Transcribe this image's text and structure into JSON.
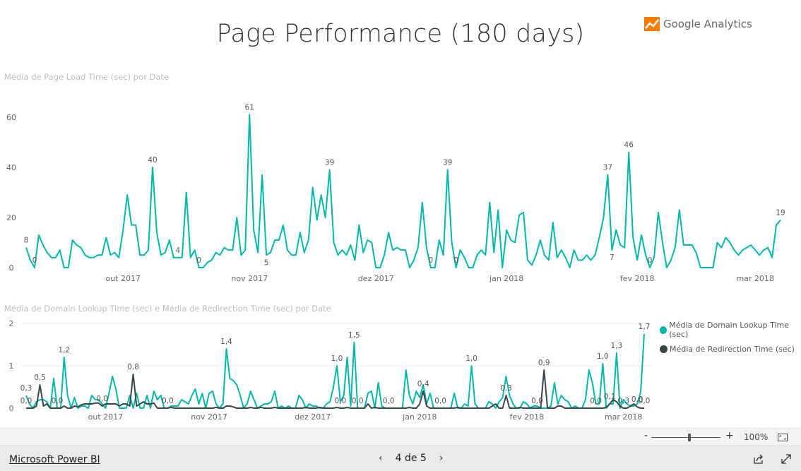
{
  "title": "Page Performance (180 days)",
  "logo": {
    "text": "Google Analytics",
    "color": "#f57c00"
  },
  "charts": [
    {
      "title": "Média de Page Load Time (sec) por Date",
      "type": "line",
      "ylim": [
        0,
        60
      ],
      "yticks": [
        "0",
        "20",
        "40",
        "60"
      ],
      "ytick_values": [
        0,
        20,
        40,
        60
      ],
      "xticks": [
        {
          "label": "out 2017",
          "at": 23
        },
        {
          "label": "nov 2017",
          "at": 53
        },
        {
          "label": "dez 2017",
          "at": 83
        },
        {
          "label": "jan 2018",
          "at": 114
        },
        {
          "label": "fev 2018",
          "at": 145
        },
        {
          "label": "mar 2018",
          "at": 173
        }
      ],
      "grid": false,
      "series": [
        {
          "name": "Média de Page Load Time (sec)",
          "color": "#01b8aa",
          "values": [
            8,
            3,
            0,
            13,
            9,
            6,
            4,
            4,
            7,
            0,
            0,
            11,
            9,
            8,
            5,
            4,
            4,
            5,
            5,
            12,
            5,
            6,
            4,
            15,
            29,
            17,
            17,
            5,
            5,
            7,
            40,
            14,
            5,
            6,
            11,
            4,
            4,
            4,
            30,
            4,
            7,
            0,
            0,
            2,
            3,
            6,
            5,
            8,
            7,
            7,
            20,
            5,
            7,
            61,
            15,
            6,
            37,
            5,
            6,
            11,
            11,
            17,
            7,
            5,
            5,
            14,
            6,
            11,
            32,
            19,
            29,
            20,
            39,
            10,
            5,
            7,
            5,
            9,
            3,
            17,
            6,
            11,
            10,
            0,
            0,
            5,
            14,
            7,
            8,
            7,
            7,
            0,
            3,
            8,
            26,
            8,
            0,
            0,
            11,
            5,
            39,
            10,
            0,
            7,
            4,
            0,
            0,
            5,
            7,
            5,
            26,
            6,
            23,
            0,
            15,
            11,
            10,
            21,
            22,
            3,
            1,
            5,
            11,
            5,
            3,
            18,
            4,
            7,
            4,
            0,
            7,
            3,
            3,
            5,
            3,
            5,
            12,
            20,
            37,
            7,
            15,
            9,
            8,
            46,
            12,
            3,
            13,
            5,
            0,
            4,
            22,
            10,
            0,
            3,
            8,
            23,
            9,
            9,
            9,
            6,
            0,
            0,
            0,
            0,
            10,
            8,
            12,
            10,
            7,
            5,
            7,
            8,
            9,
            7,
            5,
            7,
            8,
            4,
            17,
            19
          ]
        }
      ],
      "labels": [
        {
          "s": 0,
          "at": 0,
          "text": "8"
        },
        {
          "s": 0,
          "at": 2,
          "text": "0"
        },
        {
          "s": 0,
          "at": 30,
          "text": "40"
        },
        {
          "s": 0,
          "at": 36,
          "text": "4"
        },
        {
          "s": 0,
          "at": 41,
          "text": "0"
        },
        {
          "s": 0,
          "at": 53,
          "text": "61"
        },
        {
          "s": 0,
          "at": 57,
          "text": "5",
          "below": true
        },
        {
          "s": 0,
          "at": 72,
          "text": "39"
        },
        {
          "s": 0,
          "at": 96,
          "text": "0"
        },
        {
          "s": 0,
          "at": 100,
          "text": "39"
        },
        {
          "s": 0,
          "at": 102,
          "text": "0"
        },
        {
          "s": 0,
          "at": 138,
          "text": "37"
        },
        {
          "s": 0,
          "at": 139,
          "text": "7",
          "below": true
        },
        {
          "s": 0,
          "at": 143,
          "text": "46"
        },
        {
          "s": 0,
          "at": 148,
          "text": "0"
        },
        {
          "s": 0,
          "at": 179,
          "text": "19"
        }
      ]
    },
    {
      "title": "Média de Domain Lookup Time (sec) e Média de Redirection Time (sec) por Date",
      "type": "line",
      "ylim": [
        0,
        2
      ],
      "yticks": [
        "0",
        "1",
        "2"
      ],
      "ytick_values": [
        0,
        1,
        2
      ],
      "xticks": [
        {
          "label": "out 2017",
          "at": 23
        },
        {
          "label": "nov 2017",
          "at": 53
        },
        {
          "label": "dez 2017",
          "at": 83
        },
        {
          "label": "jan 2018",
          "at": 114
        },
        {
          "label": "fev 2018",
          "at": 145
        },
        {
          "label": "mar 2018",
          "at": 173
        }
      ],
      "grid": true,
      "legend": "right",
      "series": [
        {
          "name": "Média de Domain Lookup Time (sec)",
          "color": "#01b8aa",
          "values": [
            0.3,
            0.1,
            0,
            0.15,
            0.2,
            0.2,
            0.15,
            0,
            0.7,
            0,
            0,
            1.2,
            0.3,
            0,
            0.25,
            0,
            0.05,
            0.05,
            0,
            0.3,
            0.2,
            0.2,
            0.1,
            0,
            0.35,
            0.75,
            0.45,
            0,
            0,
            0,
            0.3,
            0,
            0.35,
            0,
            0,
            0.3,
            0,
            0.4,
            0.2,
            0.3,
            0,
            0,
            0.05,
            0.05,
            0.05,
            0.2,
            0.15,
            0.1,
            0.3,
            0.45,
            0.1,
            0.35,
            0,
            0.35,
            0.4,
            0.1,
            0,
            0.1,
            1.4,
            0.7,
            0.65,
            0.55,
            0.3,
            0,
            0.1,
            0.4,
            0.2,
            0,
            0.05,
            0.1,
            0.1,
            0.15,
            0.4,
            0,
            0.05,
            0,
            0.05,
            0,
            0,
            0.3,
            0.2,
            0,
            0.1,
            0.05,
            0.05,
            0,
            0,
            0.1,
            0.15,
            0.5,
            1.0,
            0.15,
            0.3,
            1.2,
            0.05,
            1.55,
            0,
            0,
            0,
            0.35,
            0.4,
            0,
            0.6,
            0.05,
            0,
            0,
            0,
            0,
            0,
            0,
            0.9,
            0.3,
            0.1,
            0.4,
            0.25,
            0.55,
            0.1,
            0.35,
            0,
            0,
            0,
            0,
            0,
            0,
            0.35,
            0,
            0,
            0.1,
            0.05,
            1.0,
            0.1,
            0,
            0,
            0,
            0.15,
            0.1,
            0,
            0.15,
            0.25,
            0.75,
            0.3,
            0.1,
            0,
            0,
            0.15,
            0.1,
            0,
            0.05,
            0.05,
            0,
            0,
            0,
            0.05,
            0.6,
            0.1,
            0.3,
            0.2,
            0.15,
            0,
            0.05,
            0,
            0,
            0.2,
            0.9,
            0.6,
            0.1,
            0.1,
            1.05,
            0,
            0.1,
            0.1,
            1.3,
            0,
            0.2,
            0.1,
            0.05,
            0.05,
            0.1,
            0.4,
            1.75
          ]
        },
        {
          "name": "Média de Redirection Time (sec)",
          "color": "#374649",
          "values": [
            0,
            0,
            0,
            0.05,
            0.55,
            0.05,
            0.1,
            0,
            0,
            0,
            0,
            0.05,
            0,
            0,
            0.05,
            0.03,
            0.08,
            0.1,
            0.1,
            0.1,
            0.12,
            0.12,
            0.05,
            0.1,
            0.1,
            0.1,
            0.1,
            0.05,
            0.1,
            0.1,
            0.05,
            0.8,
            0.05,
            0.1,
            0.15,
            0.1,
            0.1,
            0.12,
            0,
            0,
            0,
            0,
            0.02,
            0,
            0,
            0,
            0,
            0,
            0,
            0,
            0,
            0,
            0,
            0,
            0,
            0.02,
            0,
            0,
            0.05,
            0.05,
            0.03,
            0,
            0,
            0,
            0,
            0.02,
            0,
            0,
            0.02,
            0,
            0,
            0,
            0.02,
            0,
            0,
            0,
            0,
            0,
            0,
            0,
            0,
            0.02,
            0,
            0,
            0,
            0.02,
            0,
            0,
            0,
            0,
            0.02,
            0,
            0,
            0.02,
            0,
            0,
            0,
            0,
            0,
            0.1,
            0,
            0.02,
            0,
            0,
            0,
            0,
            0,
            0,
            0,
            0,
            0,
            0.02,
            0,
            0,
            0.1,
            0.4,
            0.05,
            0,
            0,
            0,
            0,
            0,
            0,
            0,
            0,
            0.02,
            0,
            0,
            0,
            0,
            0,
            0,
            0,
            0,
            0,
            0.05,
            0.1,
            0,
            0,
            0.3,
            0,
            0,
            0,
            0.02,
            0,
            0,
            0,
            0,
            0,
            0,
            0.9,
            0,
            0,
            0,
            0.05,
            0.05,
            0,
            0,
            0,
            0,
            0,
            0,
            0,
            0,
            0,
            0,
            0,
            0,
            0.02,
            0.1,
            0.2,
            0.15,
            0.05,
            0,
            0,
            0.05,
            0.1,
            0.03,
            0,
            0
          ]
        }
      ],
      "labels": [
        {
          "s": 0,
          "at": 0,
          "text": "0,3"
        },
        {
          "s": 1,
          "at": 0,
          "text": "0,0"
        },
        {
          "s": 1,
          "at": 4,
          "text": "0,5"
        },
        {
          "s": 1,
          "at": 9,
          "text": "0,0"
        },
        {
          "s": 0,
          "at": 11,
          "text": "1,2"
        },
        {
          "s": 1,
          "at": 22,
          "text": "0,0"
        },
        {
          "s": 1,
          "at": 31,
          "text": "0,8"
        },
        {
          "s": 1,
          "at": 41,
          "text": "0,0"
        },
        {
          "s": 0,
          "at": 58,
          "text": "1,4"
        },
        {
          "s": 0,
          "at": 90,
          "text": "1,0"
        },
        {
          "s": 1,
          "at": 91,
          "text": "0,0"
        },
        {
          "s": 0,
          "at": 95,
          "text": "1,5"
        },
        {
          "s": 1,
          "at": 96,
          "text": "0,0"
        },
        {
          "s": 1,
          "at": 105,
          "text": "0,0"
        },
        {
          "s": 1,
          "at": 115,
          "text": "0,4"
        },
        {
          "s": 1,
          "at": 120,
          "text": "0,0"
        },
        {
          "s": 0,
          "at": 129,
          "text": "1,0"
        },
        {
          "s": 1,
          "at": 139,
          "text": "0,3"
        },
        {
          "s": 1,
          "at": 148,
          "text": "0,0"
        },
        {
          "s": 1,
          "at": 150,
          "text": "0,9"
        },
        {
          "s": 1,
          "at": 165,
          "text": "0,0"
        },
        {
          "s": 0,
          "at": 167,
          "text": "1,0"
        },
        {
          "s": 0,
          "at": 169,
          "text": "0,1"
        },
        {
          "s": 0,
          "at": 171,
          "text": "1,3"
        },
        {
          "s": 1,
          "at": 173,
          "text": "0,3"
        },
        {
          "s": 1,
          "at": 177,
          "text": "0,0"
        },
        {
          "s": 1,
          "at": 179,
          "text": "0,0"
        },
        {
          "s": 0,
          "at": 179,
          "text": "1,7"
        }
      ]
    }
  ],
  "zoom": {
    "minus": "-",
    "plus": "+",
    "level": "100%",
    "slider_fraction": 0.55
  },
  "footer": {
    "brand": "Microsoft Power BI",
    "page": "4 de 5"
  }
}
